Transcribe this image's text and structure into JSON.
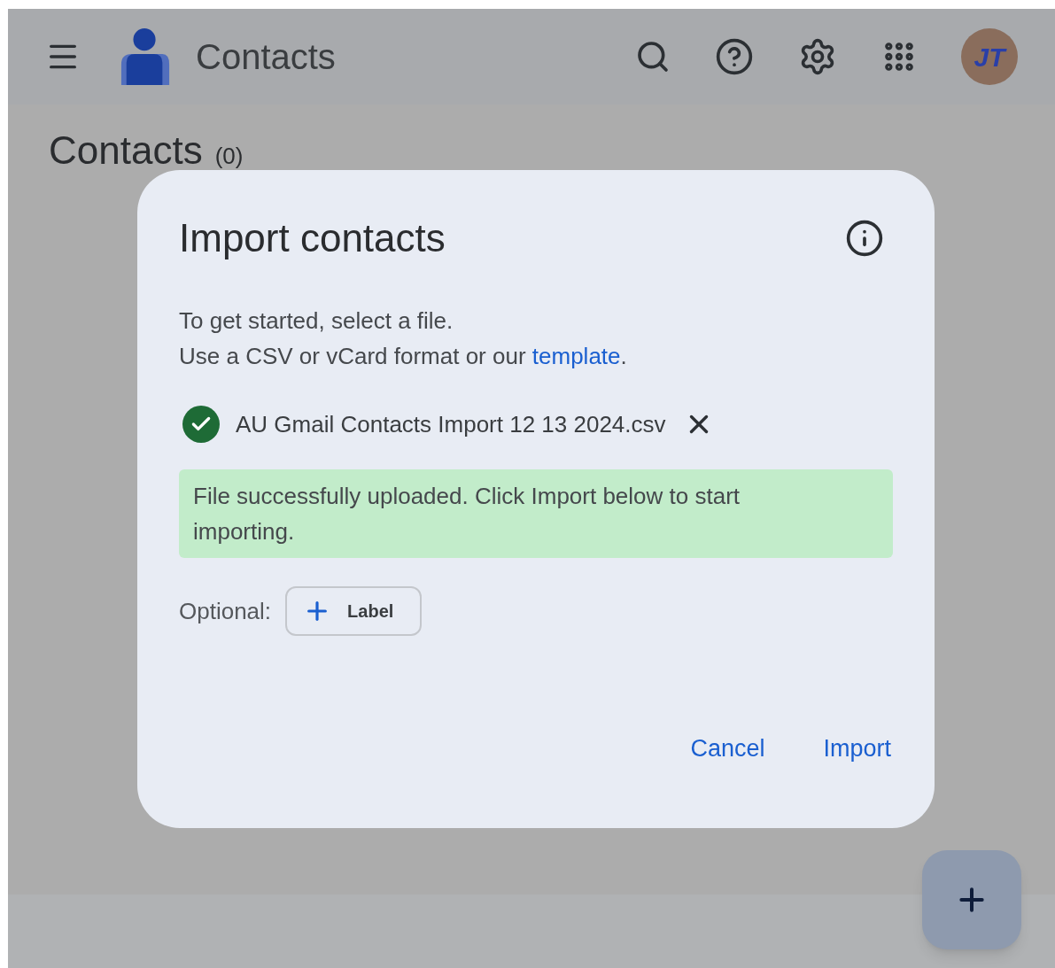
{
  "app_bar": {
    "title": "Contacts",
    "avatar_initials": "JT"
  },
  "page": {
    "heading": "Contacts",
    "count": "(0)"
  },
  "dialog": {
    "title": "Import contacts",
    "instructions": [
      "To get started, select a file.",
      "Use a CSV or vCard format or our"
    ],
    "template_link": "template",
    "after_link": ".",
    "file": {
      "name": "AU Gmail Contacts Import 12 13 2024.csv",
      "uploaded": true
    },
    "message": "File successfully uploaded. Click Import below to start importing.",
    "optional_label": "Optional:",
    "label_button": "Label",
    "buttons": [
      "Cancel",
      "Import"
    ]
  }
}
